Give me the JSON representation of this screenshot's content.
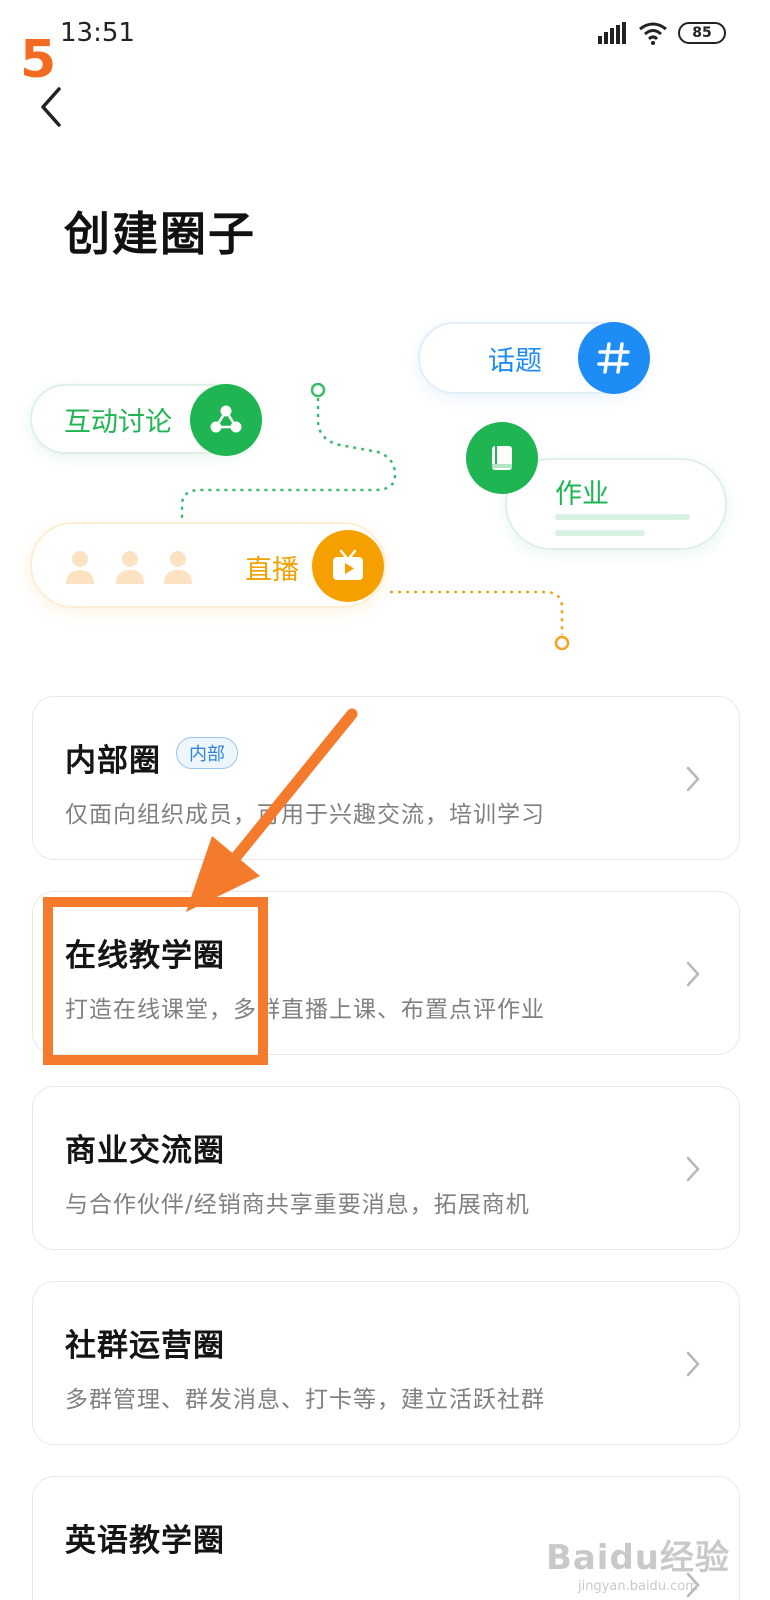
{
  "status": {
    "time": "13:51",
    "battery": "85"
  },
  "step_number": "5",
  "header": {
    "title": "创建圈子"
  },
  "illustration": {
    "topic_label": "话题",
    "discussion_label": "互动讨论",
    "homework_label": "作业",
    "live_label": "直播",
    "colors": {
      "green": "#1fb552",
      "blue": "#1e8cf5",
      "orange": "#f6a000"
    }
  },
  "circle_types": [
    {
      "title": "内部圈",
      "badge": "内部",
      "description": "仅面向组织成员，可用于兴趣交流，培训学习"
    },
    {
      "title": "在线教学圈",
      "description": "打造在线课堂，多群直播上课、布置点评作业"
    },
    {
      "title": "商业交流圈",
      "description": "与合作伙伴/经销商共享重要消息，拓展商机"
    },
    {
      "title": "社群运营圈",
      "description": "多群管理、群发消息、打卡等，建立活跃社群"
    },
    {
      "title": "英语教学圈",
      "description": ""
    }
  ],
  "annotation": {
    "color": "#f47a2c"
  },
  "watermark": {
    "main": "Baidu经验",
    "sub": "jingyan.baidu.com"
  }
}
